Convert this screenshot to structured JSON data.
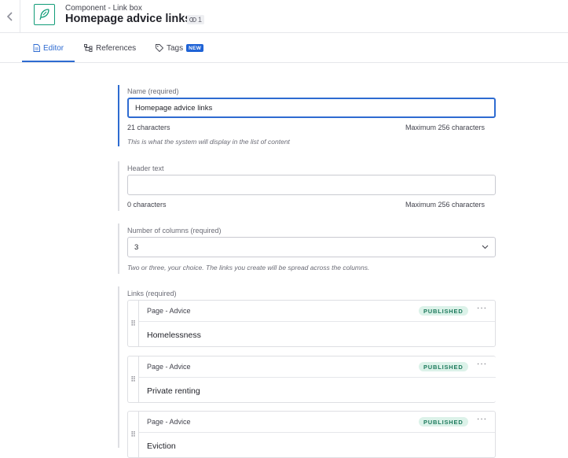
{
  "header": {
    "subtitle": "Component - Link box",
    "title": "Homepage advice links",
    "ref_count": "1"
  },
  "tabs": [
    {
      "label": "Editor",
      "active": true
    },
    {
      "label": "References"
    },
    {
      "label": "Tags",
      "badge": "NEW"
    }
  ],
  "fields": {
    "name": {
      "label": "Name (required)",
      "value": "Homepage advice links",
      "count": "21 characters",
      "max": "Maximum 256 characters",
      "hint": "This is what the system will display in the list of content"
    },
    "header_text": {
      "label": "Header text",
      "value": "",
      "count": "0 characters",
      "max": "Maximum 256 characters"
    },
    "columns": {
      "label": "Number of columns (required)",
      "value": "3",
      "hint": "Two or three, your choice. The links you create will be spread across the columns."
    },
    "links": {
      "label": "Links (required)",
      "items": [
        {
          "type": "Page - Advice",
          "status": "PUBLISHED",
          "title": "Homelessness"
        },
        {
          "type": "Page - Advice",
          "status": "PUBLISHED",
          "title": "Private renting"
        },
        {
          "type": "Page - Advice",
          "status": "PUBLISHED",
          "title": "Eviction"
        }
      ]
    }
  },
  "colors": {
    "accent": "#2e6bd1",
    "brand_green": "#119c78",
    "published_bg": "#dcf2e9",
    "published_text": "#1d7a5c"
  },
  "icons": {
    "back": "chevron-left-icon",
    "logo": "feather-icon",
    "ref": "link-icon",
    "editor_tab": "document-icon",
    "references_tab": "hierarchy-icon",
    "tags_tab": "tag-icon",
    "select": "chevron-down-icon",
    "drag": "drag-handle-icon",
    "menu": "ellipsis-icon"
  }
}
